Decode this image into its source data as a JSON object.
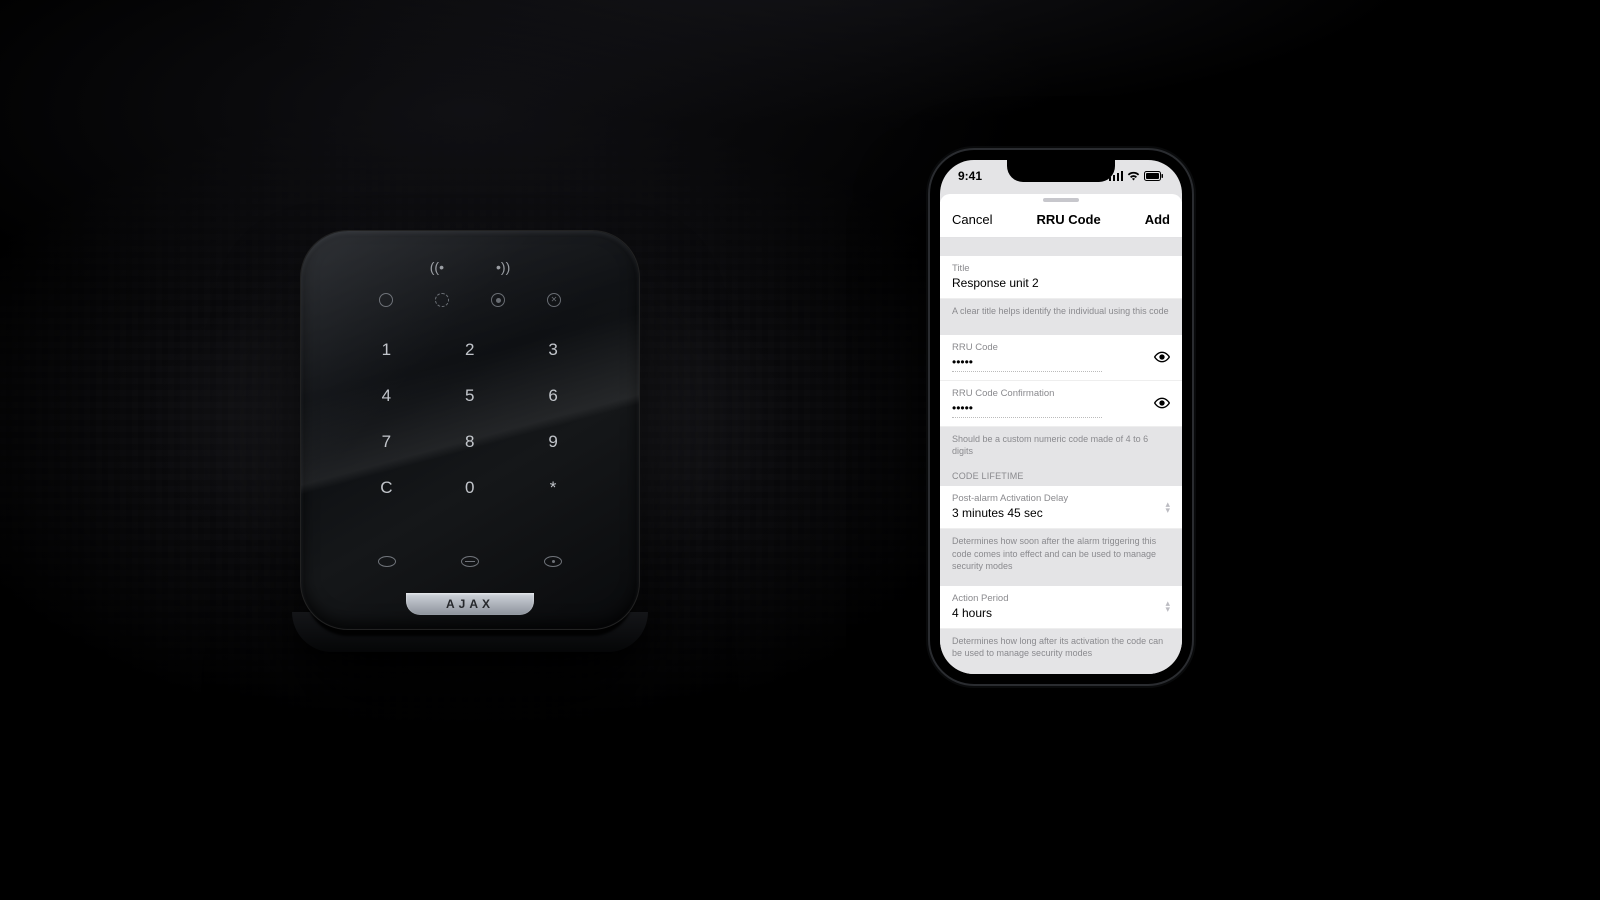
{
  "keypad": {
    "brand": "AJAX",
    "keys": [
      "1",
      "2",
      "3",
      "4",
      "5",
      "6",
      "7",
      "8",
      "9",
      "C",
      "0",
      "*"
    ]
  },
  "phone": {
    "status": {
      "time": "9:41"
    },
    "navbar": {
      "cancel": "Cancel",
      "title": "RRU Code",
      "add": "Add"
    },
    "title_field": {
      "label": "Title",
      "value": "Response unit 2"
    },
    "title_hint": "A clear title helps identify the individual using this code",
    "code_field": {
      "label": "RRU Code",
      "value": "•••••"
    },
    "confirm_field": {
      "label": "RRU Code Confirmation",
      "value": "•••••"
    },
    "code_hint": "Should be a custom numeric code made of 4 to 6 digits",
    "lifetime_header": "CODE LIFETIME",
    "delay": {
      "label": "Post-alarm Activation Delay",
      "value": "3 minutes 45 sec"
    },
    "delay_hint": "Determines how soon after the alarm triggering this code comes into effect and can be used to manage security modes",
    "action": {
      "label": "Action Period",
      "value": "4 hours"
    },
    "action_hint": "Determines how long after its activation the code can be used to manage security modes"
  }
}
